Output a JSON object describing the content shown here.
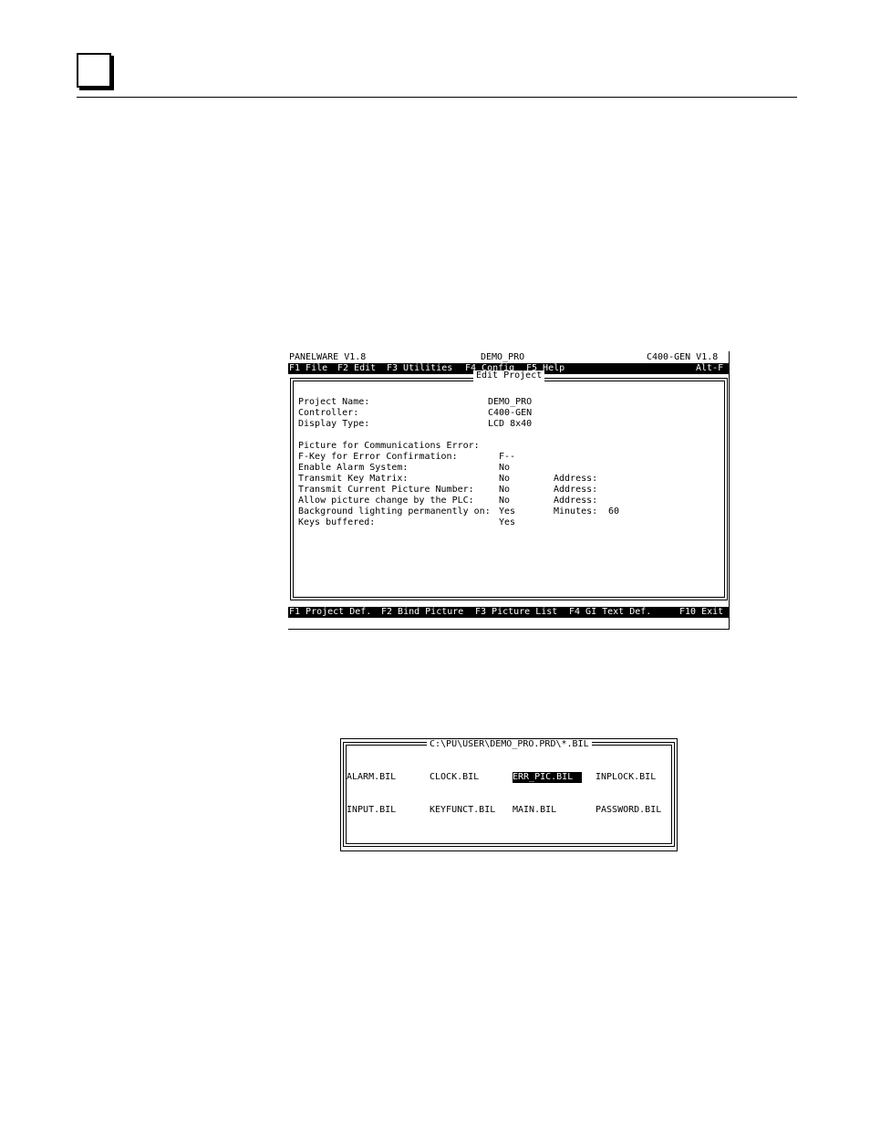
{
  "screen": {
    "app_name": "PANELWARE V1.8",
    "project": "DEMO_PRO",
    "controller_version": "C400-GEN V1.8",
    "menu": [
      "F1 File",
      "F2 Edit",
      "F3 Utilities",
      "F4 Config",
      "F5 Help"
    ],
    "menu_shortcut": "Alt-F",
    "dialog_title": "Edit Project",
    "fields": {
      "project_name_label": "Project Name:",
      "project_name_value": "DEMO_PRO",
      "controller_label": "Controller:",
      "controller_value": "C400-GEN",
      "display_type_label": "Display Type:",
      "display_type_value": "LCD 8x40",
      "comm_error_label": "Picture for Communications Error:",
      "fkey_label": "F-Key for Error Confirmation:",
      "fkey_value": "F--",
      "alarm_label": "Enable Alarm System:",
      "alarm_value": "No",
      "key_matrix_label": "Transmit Key Matrix:",
      "key_matrix_value": "No",
      "key_matrix_addr": "Address:",
      "cur_pic_label": "Transmit Current Picture Number:",
      "cur_pic_value": "No",
      "cur_pic_addr": "Address:",
      "allow_pic_label": "Allow picture change by the PLC:",
      "allow_pic_value": "No",
      "allow_pic_addr": "Address:",
      "bg_light_label": "Background lighting permanently on:",
      "bg_light_value": "Yes",
      "minutes_label": "Minutes:",
      "minutes_value": "60",
      "keys_buffered_label": "Keys buffered:",
      "keys_buffered_value": "Yes"
    },
    "fkeys": [
      "F1 Project Def.",
      "F2 Bind Picture",
      "F3 Picture List",
      "F4 GI Text Def.",
      "F10 Exit"
    ]
  },
  "file_dialog": {
    "path": "C:\\PU\\USER\\DEMO_PRO.PRD\\*.BIL",
    "rows": [
      [
        "ALARM.BIL",
        "CLOCK.BIL",
        "ERR_PIC.BIL",
        "INPLOCK.BIL"
      ],
      [
        "INPUT.BIL",
        "KEYFUNCT.BIL",
        "MAIN.BIL",
        "PASSWORD.BIL"
      ]
    ],
    "selected": "ERR_PIC.BIL"
  }
}
